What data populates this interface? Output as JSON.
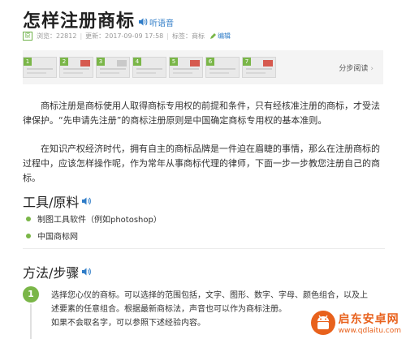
{
  "article": {
    "title": "怎样注册商标",
    "listen_label": "听语音"
  },
  "meta": {
    "badge": "原",
    "views": "浏览：22812",
    "updated": "更新：2017-09-09 17:58",
    "tags": "标签：商标",
    "edit_label": "编辑"
  },
  "steps_strip": {
    "thumbs": [
      "1",
      "2",
      "3",
      "4",
      "5",
      "6",
      "7"
    ],
    "step_read_label": "分步阅读",
    "arrow": "›"
  },
  "intro": {
    "p1": "商标注册是商标使用人取得商标专用权的前提和条件，只有经核准注册的商标，才受法律保护。“先申请先注册”的商标注册原则是中国确定商标专用权的基本准则。",
    "p2": "在知识产权经济时代，拥有自主的商标品牌是一件迫在眉睫的事情，那么在注册商标的过程中，应该怎样操作呢，作为常年从事商标代理的律师，下面一步一步教您注册自己的商标。"
  },
  "tools": {
    "heading": "工具/原料",
    "items": [
      "制图工具软件（例如photoshop）",
      "中国商标网"
    ]
  },
  "method": {
    "heading": "方法/步骤",
    "step_number": "1",
    "lines": [
      "选择您心仪的商标。可以选择的范围包括，文字、图形、数字、字母、颜色组合，以及上",
      "述要素的任意组合。根据最新商标法，声音也可以作为商标注册。",
      "如果不会取名字，可以参照下述经验内容。"
    ]
  },
  "watermark": {
    "name": "启东安卓网",
    "url": "www.qdlaitu.com"
  }
}
